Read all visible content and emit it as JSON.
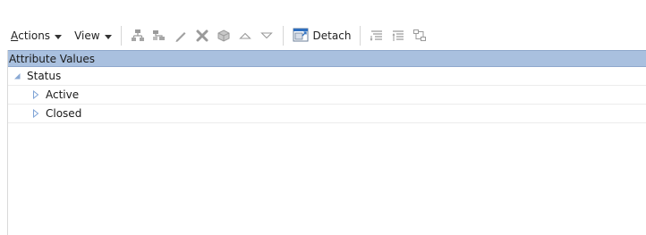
{
  "toolbar": {
    "actions_label": "Actions",
    "actions_mnemonic": "A",
    "actions_rest": "ctions",
    "view_label": "View",
    "detach_label": "Detach",
    "icons": [
      "add-sibling-icon",
      "add-child-icon",
      "edit-icon",
      "delete-icon",
      "cube-icon",
      "move-up-icon",
      "move-down-icon",
      "detach-icon",
      "expand-all-icon",
      "collapse-all-icon",
      "hierarchy-icon"
    ]
  },
  "tree": {
    "header": "Attribute Values",
    "root": {
      "label": "Status",
      "expanded": true,
      "children": [
        {
          "label": "Active",
          "expanded": false
        },
        {
          "label": "Closed",
          "expanded": false
        }
      ]
    }
  },
  "colors": {
    "header_bg": "#a9c0df",
    "disclosure": "#7ea3d6"
  }
}
